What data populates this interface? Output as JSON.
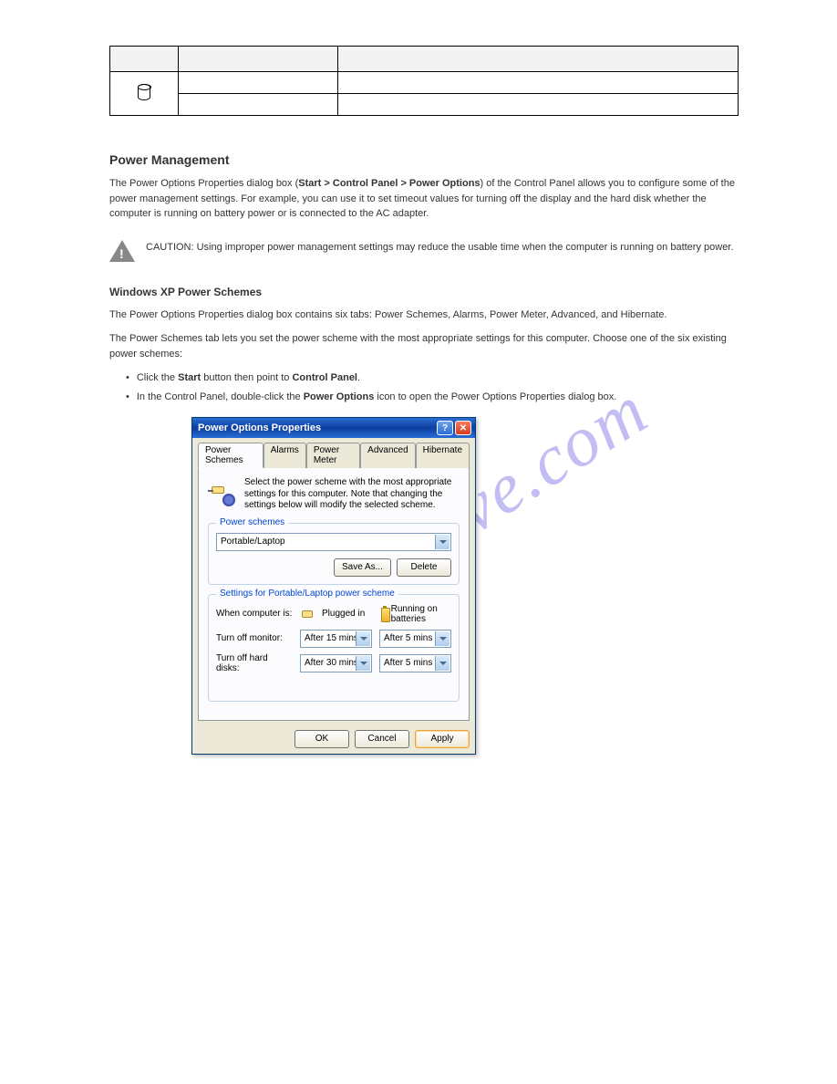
{
  "watermark": "manualshive.com",
  "table": {
    "headers": [
      "",
      "",
      ""
    ],
    "icon_name": "hdd-icon",
    "rows": [
      [
        "",
        ""
      ],
      [
        "",
        ""
      ]
    ]
  },
  "sections": {
    "title1": "Power Management",
    "p1_a": "The Power Options Properties dialog box (",
    "p1_path": "Start > Control Panel > Power Options",
    "p1_b": ") of the Control Panel allows you to configure some of the power management settings. For example, you can use it to set timeout values for turning off the display and the hard disk whether the computer is running on battery power or is connected to the AC adapter.",
    "warn": "CAUTION: Using improper power management settings may reduce the usable time when the computer is running on battery power.",
    "title2": "Windows XP Power Schemes",
    "p2": "The Power Options Properties dialog box contains six tabs: Power Schemes, Alarms, Power Meter, Advanced, and Hibernate.",
    "p3": "The Power Schemes tab lets you set the power scheme with the most appropriate settings for this computer. Choose one of the six existing power schemes:",
    "bullets": [
      "Click the ",
      "Start",
      " button then point to ",
      "Control Panel",
      "."
    ],
    "bullet_line2_a": "In the Control Panel, double-click the ",
    "bullet_line2_b": "Power Options",
    "bullet_line2_c": " icon to open the Power Options Properties dialog box."
  },
  "dialog": {
    "title": "Power Options Properties",
    "help_label": "?",
    "close_label": "✕",
    "tabs": [
      "Power Schemes",
      "Alarms",
      "Power Meter",
      "Advanced",
      "Hibernate"
    ],
    "active_tab": 0,
    "intro": "Select the power scheme with the most appropriate settings for this computer. Note that changing the settings below will modify the selected scheme.",
    "fieldset1_legend": "Power schemes",
    "scheme_value": "Portable/Laptop",
    "save_as": "Save As...",
    "delete": "Delete",
    "fieldset2_legend": "Settings for Portable/Laptop power scheme",
    "when_label": "When computer is:",
    "plugged_label": "Plugged in",
    "battery_label": "Running on batteries",
    "row1_label": "Turn off monitor:",
    "row1_plugged": "After 15 mins",
    "row1_batt": "After 5 mins",
    "row2_label": "Turn off hard disks:",
    "row2_plugged": "After 30 mins",
    "row2_batt": "After 5 mins",
    "ok": "OK",
    "cancel": "Cancel",
    "apply": "Apply"
  }
}
